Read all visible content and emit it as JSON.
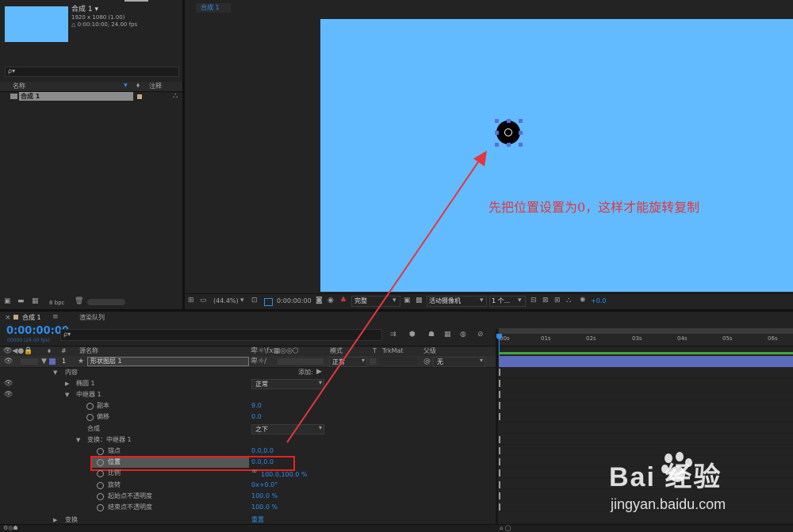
{
  "project": {
    "comp_name": "合成 1 ▾",
    "comp_dims": "1920 x 1080 (1.00)",
    "comp_duration": "△ 0:00:10:00, 24.00 fps",
    "search_placeholder": "ρ▾",
    "col_name": "名称",
    "col_comment": "注释",
    "item_name": "合成 1",
    "bpc": "8 bpc"
  },
  "viewer": {
    "tab": "合成 1",
    "annotation": "先把位置设置为0，这样才能旋转复制",
    "zoom": "(44.4%)",
    "timecode": "0:00:00:00",
    "quality": "完整",
    "camera": "活动摄像机",
    "views": "1 个...",
    "exposure": "+0.0"
  },
  "timeline": {
    "tab_comp": "合成 1",
    "tab_render": "渲染队列",
    "timecode": "0:00:00:00",
    "fps": "00000 (24.00 fps)",
    "search_placeholder": "ρ▾",
    "col_num": "#",
    "col_source": "源名称",
    "col_mode": "模式",
    "col_t": "T",
    "col_trkmat": "TrkMat",
    "col_parent": "父级",
    "layer_num": "1",
    "layer_name": "形状图层 1",
    "mode_value": "正常",
    "parent_value": "无",
    "ruler": [
      "00s",
      "01s",
      "02s",
      "03s",
      "04s",
      "05s",
      "06s"
    ],
    "props": {
      "content": "内容",
      "add": "添加:",
      "ellipse": "椭圆 1",
      "ellipse_mode": "正常",
      "repeater": "中继器 1",
      "copies": "副本",
      "copies_val": "9.0",
      "offset": "偏移",
      "offset_val": "0.0",
      "composite": "合成",
      "composite_val": "之下",
      "transform_rep": "变换：中继器 1",
      "anchor": "锚点",
      "anchor_val": "0.0,0.0",
      "position": "位置",
      "position_val": "0.0,0.0",
      "scale": "比例",
      "scale_val": "100.0,100.0 %",
      "rotation": "旋转",
      "rotation_val": "0x+0.0°",
      "start_opacity": "起始点不透明度",
      "start_opacity_val": "100.0 %",
      "end_opacity": "结束点不透明度",
      "end_opacity_val": "100.0 %",
      "transform": "变换",
      "reset": "重置"
    }
  },
  "watermark": {
    "brand": "Bai 经验",
    "url": "jingyan.baidu.com"
  },
  "colors": {
    "comp_bg": "#62bbff",
    "annotation": "#e0383e",
    "arrow": "#e0383e",
    "highlight_box": "#e8211c",
    "timecode_blue": "#2d8ceb",
    "layer_bar": "#5d6bbd"
  }
}
